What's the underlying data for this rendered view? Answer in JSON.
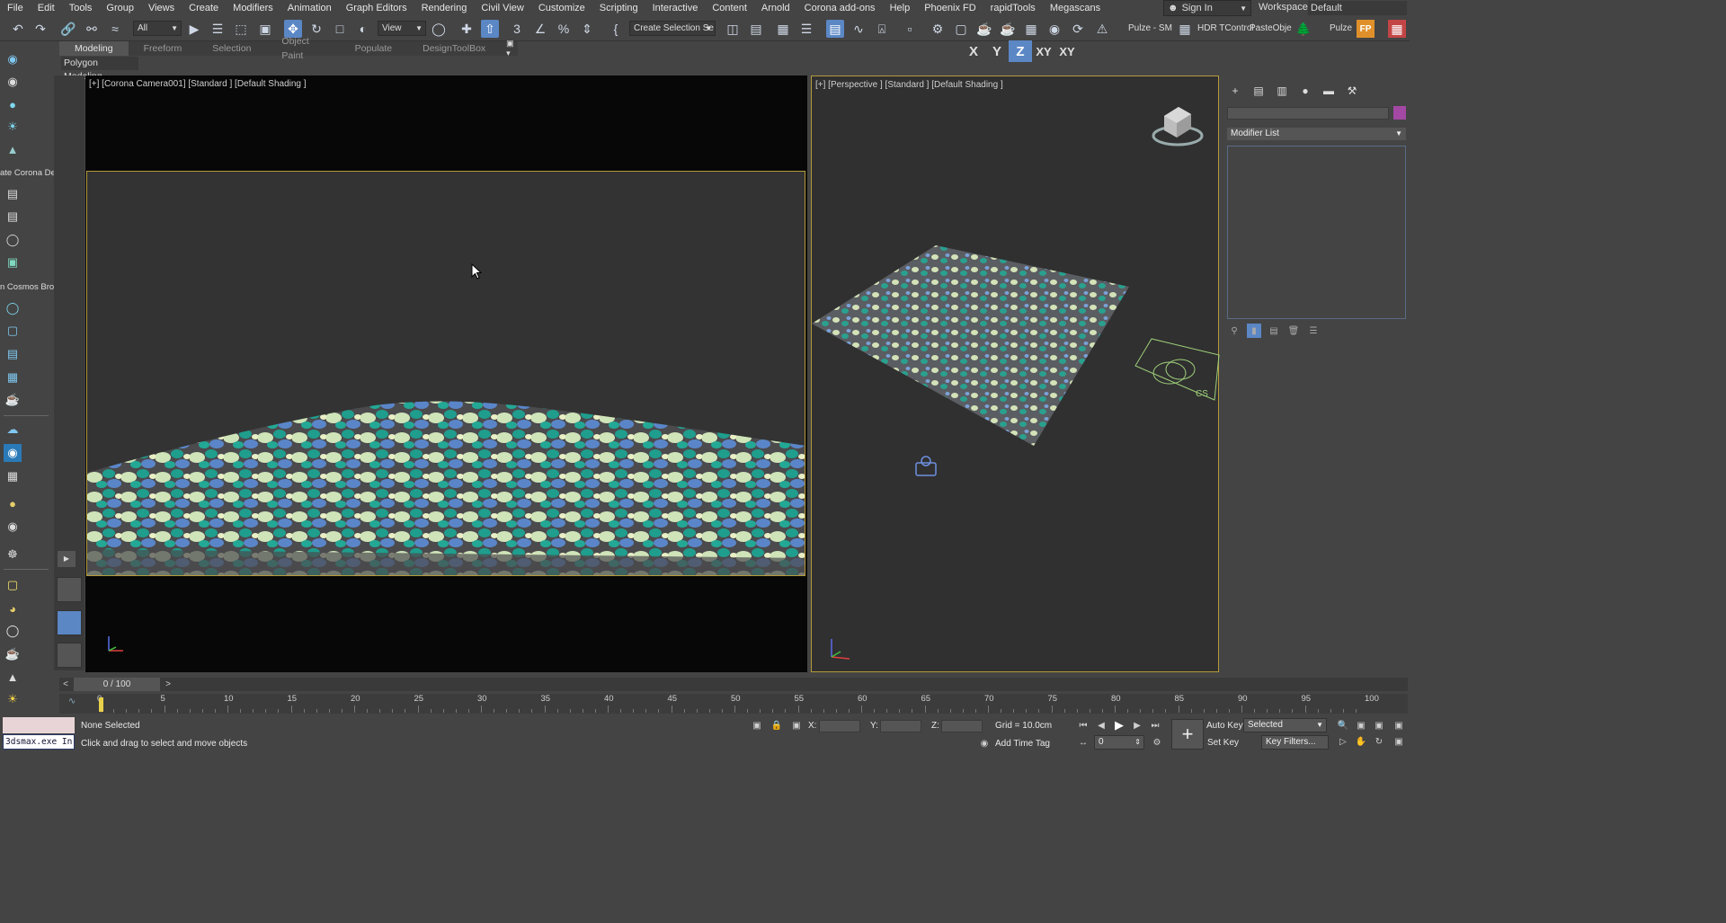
{
  "menu": [
    "File",
    "Edit",
    "Tools",
    "Group",
    "Views",
    "Create",
    "Modifiers",
    "Animation",
    "Graph Editors",
    "Rendering",
    "Civil View",
    "Customize",
    "Scripting",
    "Interactive",
    "Content",
    "Arnold",
    "Corona add-ons",
    "Help",
    "Phoenix FD",
    "rapidTools",
    "Megascans"
  ],
  "account": {
    "signin": "Sign In",
    "workspaces_label": "Workspaces:",
    "workspace_value": "Default"
  },
  "toolbar": {
    "filter_value": "All",
    "refcoord_value": "View",
    "selection_set_placeholder": "Create Selection Se",
    "pulze_sm": "Pulze - SM",
    "hdr_tcontrol": "HDR TControl",
    "paste_obj": "PasteObje",
    "pulze": "Pulze"
  },
  "ribbon": {
    "tabs": [
      "Modeling",
      "Freeform",
      "Selection",
      "Object Paint",
      "Populate",
      "DesignToolBox"
    ],
    "active_tab": "Modeling",
    "sub_label": "Polygon Modeling"
  },
  "axis_constraints": [
    "X",
    "Y",
    "Z",
    "XY",
    "XY"
  ],
  "left_panel": {
    "label_corona": "ate Corona De",
    "label_cosmos": "n Cosmos Brou"
  },
  "viewports": {
    "left_label": "[+] [Corona Camera001] [Standard ] [Default Shading ]",
    "right_label": "[+] [Perspective ] [Standard ] [Default Shading ]",
    "cs_label": "CS"
  },
  "command_panel": {
    "modifier_list": "Modifier List",
    "accent_color": "#a349a4"
  },
  "timeline": {
    "position": "0 / 100",
    "prev": "<",
    "next": ">",
    "ticks": [
      "0",
      "5",
      "10",
      "15",
      "20",
      "25",
      "30",
      "35",
      "40",
      "45",
      "50",
      "55",
      "60",
      "65",
      "70",
      "75",
      "80",
      "85",
      "90",
      "95",
      "100"
    ]
  },
  "status": {
    "maxscript": "3dsmax.exe In",
    "selection": "None Selected",
    "prompt": "Click and drag to select and move objects",
    "x_label": "X:",
    "y_label": "Y:",
    "z_label": "Z:",
    "grid": "Grid = 10.0cm",
    "add_time_tag": "Add Time Tag",
    "auto_key": "Auto Key",
    "set_key": "Set Key",
    "selected_value": "Selected",
    "key_filters": "Key Filters...",
    "frame_value": "0"
  },
  "colors": {
    "accent": "#5b87c5",
    "frame": "#b49b3a"
  }
}
